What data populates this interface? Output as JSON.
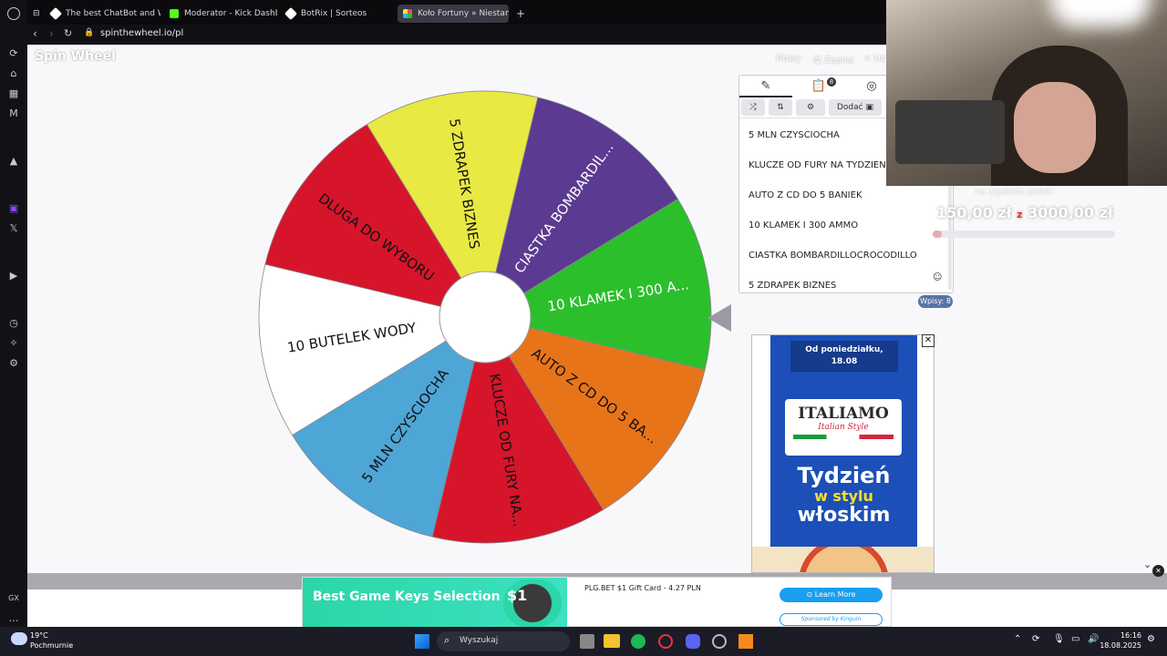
{
  "browser": {
    "tabs": [
      {
        "label": "The best ChatBot and Wi",
        "fav": "#ffffff"
      },
      {
        "label": "Moderator - Kick Dashbo",
        "fav": "#53fc18"
      },
      {
        "label": "BotRix | Sorteos",
        "fav": "#ffffff"
      },
      {
        "label": "Koło Fortuny » Niestandar",
        "fav": "#e84a5f"
      }
    ],
    "url": "spinthewheel.io/pl"
  },
  "site": {
    "logo": "Spin Wheel",
    "nav": {
      "new": "Nowy",
      "save": "Zapisz",
      "share": "Ud"
    }
  },
  "wheel": {
    "segments": [
      {
        "label": "10 KLAMEK I 300 A...",
        "color": "#2cbf2c"
      },
      {
        "label": "AUTO Z CD DO 5 BA...",
        "color": "#e8741a"
      },
      {
        "label": "KLUCZE OD FURY NA...",
        "color": "#d6152b"
      },
      {
        "label": "5 MLN CZYSCIOCHA",
        "color": "#4da6d6"
      },
      {
        "label": "10 BUTELEK WODY",
        "color": "#ffffff"
      },
      {
        "label": "DLUGA DO WYBORU",
        "color": "#d6152b"
      },
      {
        "label": "5 ZDRAPEK BIZNES",
        "color": "#e9e943"
      },
      {
        "label": "CIASTKA BOMBARDIL...",
        "color": "#5b3a91"
      }
    ]
  },
  "panel": {
    "badge_count": "8",
    "add_label": "Dodać",
    "entries": [
      "5 MLN CZYSCIOCHA",
      "KLUCZE OD FURY NA TYDZIEN",
      "AUTO Z CD DO 5 BANIEK",
      "10 KLAMEK I 300 AMMO",
      "CIASTKA BOMBARDILLOCROCODILLO",
      "5 ZDRAPEK BIZNES"
    ],
    "entry_count_label": "Wpisy: 8"
  },
  "overlay": {
    "goal_amount": "150,00 zł",
    "goal_sep": "z",
    "goal_total": "3000,00 zł",
    "goal_caption": "na zajebista palole"
  },
  "ad": {
    "line1": "Od poniedziałku,",
    "line2": "18.08",
    "brand": "ITALIAMO",
    "tagline": "Italian Style",
    "headline1": "Tydzień",
    "headline2": "w stylu",
    "headline3": "włoskim"
  },
  "banner": {
    "title": "Best Game Keys Selection",
    "price": "$1",
    "product": "PLG.BET $1 Gift Card - 4.27 PLN",
    "cta": "Learn More",
    "sponsor": "Sponsored by Kinguin"
  },
  "sidebar": {
    "gx_label": "GX"
  },
  "taskbar": {
    "weather_temp": "19°C",
    "weather_desc": "Pochmurnie",
    "search_placeholder": "Wyszukaj",
    "time": "16:16",
    "date": "18.08.2025"
  }
}
